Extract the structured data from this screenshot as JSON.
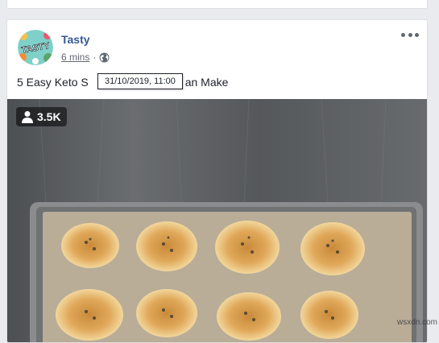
{
  "post": {
    "author": "Tasty",
    "avatar_text": "TASTY",
    "time": "6 mins",
    "separator": "·",
    "privacy_icon": "globe-icon",
    "more_icon": "ellipsis-icon",
    "text_before": "5 Easy Keto S",
    "text_after": "an Make",
    "tooltip": "31/10/2019, 11:00"
  },
  "video": {
    "views": "3.5K",
    "views_icon": "person-icon"
  },
  "watermark": "wsxdn.com",
  "colors": {
    "link": "#365899",
    "page_bg": "#e9ebee",
    "meta": "#616770"
  }
}
